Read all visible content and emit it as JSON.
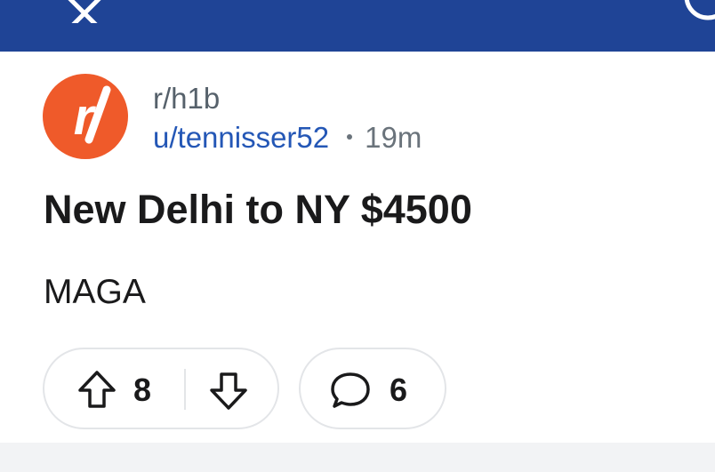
{
  "colors": {
    "header_bg": "#1f4496",
    "avatar_bg": "#ef5a2a",
    "username": "#2457b6",
    "muted_text": "#6a737b",
    "body_text": "#1a1a1b"
  },
  "header": {
    "close_icon": "close-icon",
    "right_icon": "search-icon"
  },
  "post": {
    "avatar_icon": "subreddit-avatar",
    "subreddit": "r/h1b",
    "username": "u/tennisser52",
    "time": "19m",
    "title": "New Delhi to NY $4500",
    "body": "MAGA"
  },
  "actions": {
    "upvote_icon": "arrow-up-icon",
    "vote_count": "8",
    "downvote_icon": "arrow-down-icon",
    "comment_icon": "comment-icon",
    "comment_count": "6"
  }
}
